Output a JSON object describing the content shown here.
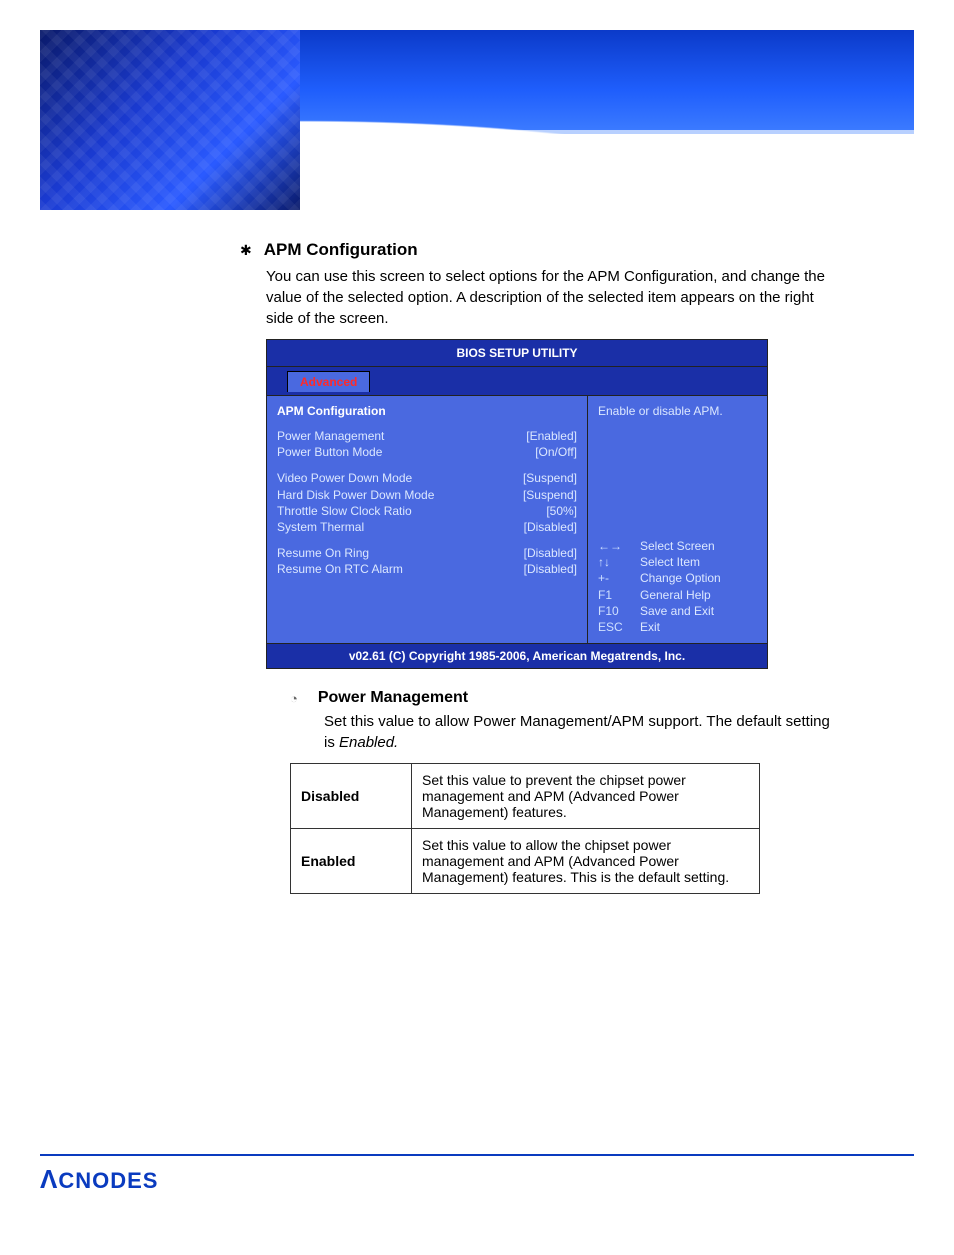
{
  "section": {
    "title": "APM Configuration",
    "description": "You can use this screen to select options for the APM Configuration, and change the value of the selected option. A description of the selected item appears on the right side of the screen."
  },
  "bios": {
    "title": "BIOS SETUP UTILITY",
    "tab": "Advanced",
    "panel_header": "APM Configuration",
    "items_group1": [
      {
        "label": "Power Management",
        "value": "[Enabled]"
      },
      {
        "label": "Power Button Mode",
        "value": "[On/Off]"
      }
    ],
    "items_group2": [
      {
        "label": "Video Power Down Mode",
        "value": "[Suspend]"
      },
      {
        "label": "Hard Disk Power Down Mode",
        "value": "[Suspend]"
      },
      {
        "label": "Throttle Slow Clock Ratio",
        "value": "[50%]"
      },
      {
        "label": "System Thermal",
        "value": "[Disabled]"
      }
    ],
    "items_group3": [
      {
        "label": "Resume On Ring",
        "value": "[Disabled]"
      },
      {
        "label": "Resume On RTC Alarm",
        "value": "[Disabled]"
      }
    ],
    "help_text": "Enable or disable APM.",
    "keys": [
      {
        "key": "←→",
        "action": "Select Screen"
      },
      {
        "key": "↑↓",
        "action": "Select Item"
      },
      {
        "key": "+-",
        "action": "Change Option"
      },
      {
        "key": "F1",
        "action": "General Help"
      },
      {
        "key": "F10",
        "action": "Save and Exit"
      },
      {
        "key": "ESC",
        "action": "Exit"
      }
    ],
    "footer": "v02.61 (C) Copyright 1985-2006, American Megatrends, Inc."
  },
  "sub": {
    "title": "Power Management",
    "description_pre": "Set this value to allow Power Management/APM support. The default setting is ",
    "description_em": "Enabled.",
    "options": [
      {
        "name": "Disabled",
        "text": "Set this value to prevent the chipset power management and APM (Advanced Power Management) features."
      },
      {
        "name": "Enabled",
        "text": "Set this value to allow the chipset power management and APM (Advanced Power Management) features. This is the default setting."
      }
    ]
  },
  "brand": "ACNODES"
}
